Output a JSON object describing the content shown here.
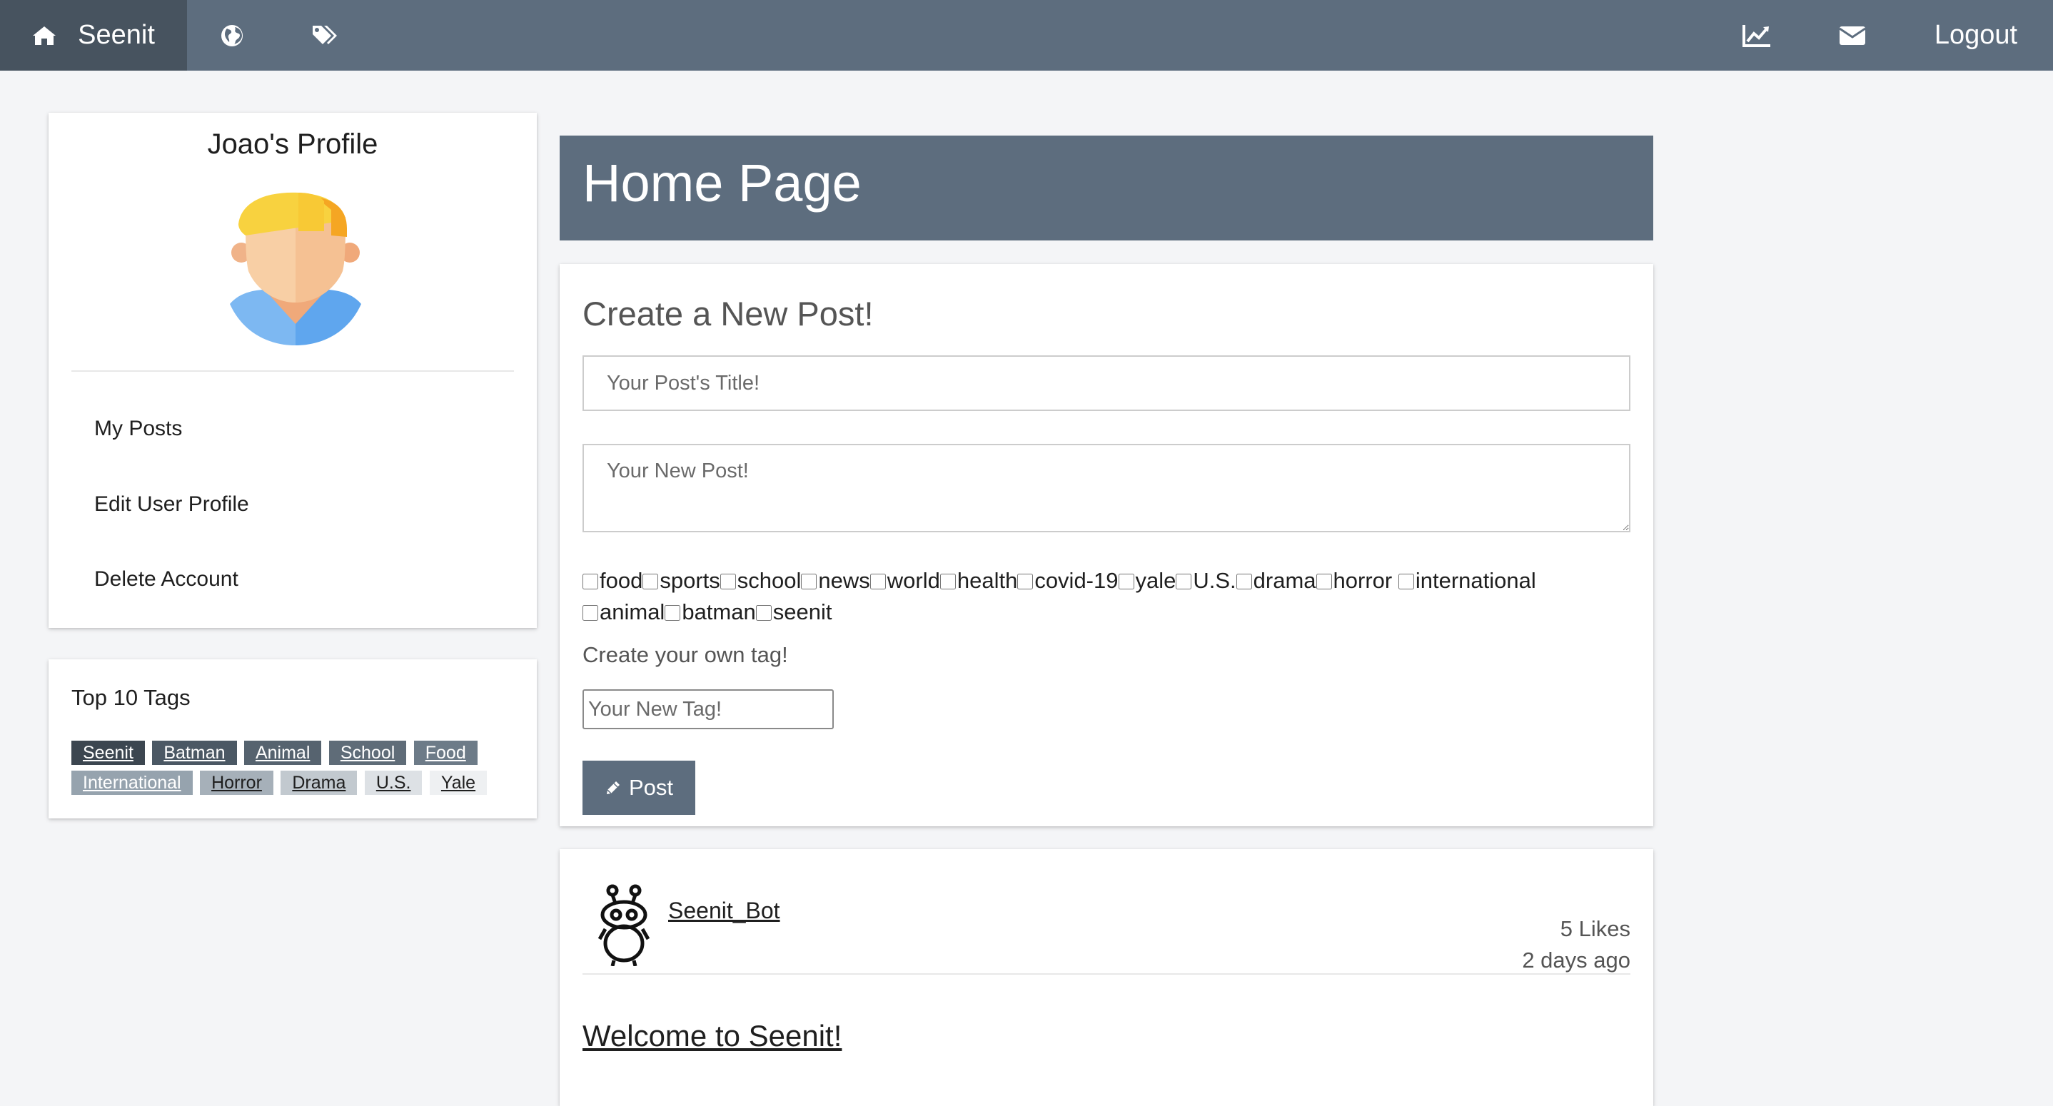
{
  "nav": {
    "brand": "Seenit",
    "logout": "Logout",
    "icons": [
      "home-icon",
      "globe-icon",
      "tags-icon",
      "chart-icon",
      "envelope-icon"
    ]
  },
  "profile": {
    "title": "Joao's Profile",
    "links": [
      "My Posts",
      "Edit User Profile",
      "Delete Account"
    ]
  },
  "top_tags": {
    "title": "Top 10 Tags",
    "tags": [
      {
        "label": "Seenit",
        "bg": "#3c4650",
        "fg": "#ffffff"
      },
      {
        "label": "Batman",
        "bg": "#4b5864",
        "fg": "#ffffff"
      },
      {
        "label": "Animal",
        "bg": "#56636f",
        "fg": "#ffffff"
      },
      {
        "label": "School",
        "bg": "#5f6c78",
        "fg": "#ffffff"
      },
      {
        "label": "Food",
        "bg": "#6d7b88",
        "fg": "#ffffff"
      },
      {
        "label": "International",
        "bg": "#96a3ae",
        "fg": "#ffffff"
      },
      {
        "label": "Horror",
        "bg": "#a6b0b9",
        "fg": "#1f1f1f"
      },
      {
        "label": "Drama",
        "bg": "#c2c9cf",
        "fg": "#1f1f1f"
      },
      {
        "label": "U.S.",
        "bg": "#dde1e5",
        "fg": "#1f1f1f"
      },
      {
        "label": "Yale",
        "bg": "#eef0f2",
        "fg": "#1f1f1f"
      }
    ]
  },
  "header": {
    "title": "Home Page"
  },
  "create_post": {
    "heading": "Create a New Post!",
    "title_placeholder": "Your Post's Title!",
    "body_placeholder": "Your New Post!",
    "tag_options": [
      "food",
      "sports",
      "school",
      "news",
      "world",
      "health",
      "covid-19",
      "yale",
      "U.S.",
      "drama",
      "horror",
      "international",
      "animal",
      "batman",
      "seenit"
    ],
    "own_tag_label": "Create your own tag!",
    "new_tag_placeholder": "Your New Tag!",
    "post_button": "Post"
  },
  "feed": {
    "author": "Seenit_Bot",
    "likes": "5 Likes",
    "time_ago": "2 days ago",
    "post_title": "Welcome to Seenit!"
  },
  "colors": {
    "nav_bg": "#5d6d7e",
    "nav_active": "#47535f",
    "page_bg": "#f4f5f7"
  }
}
